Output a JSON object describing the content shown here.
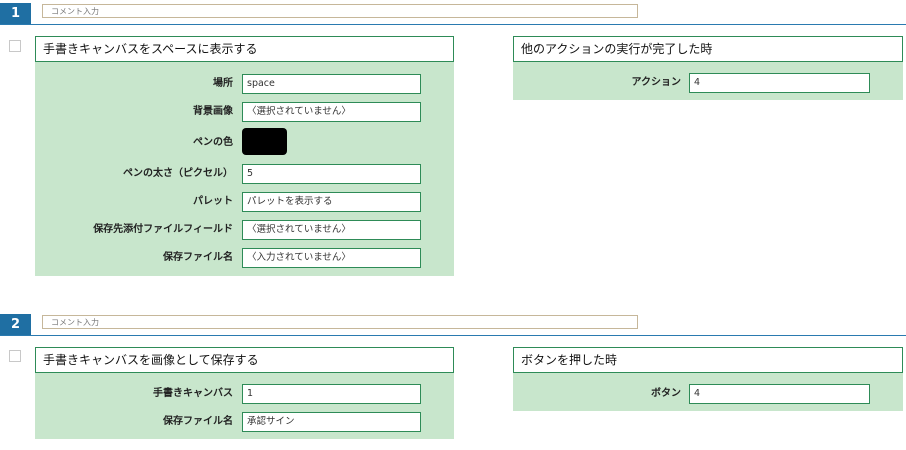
{
  "blocks": [
    {
      "number": "1",
      "comment_placeholder": "コメント入力",
      "action": {
        "title": "手書きキャンバスをスペースに表示する",
        "fields": [
          {
            "label": "場所",
            "value": "space"
          },
          {
            "label": "背景画像",
            "value": "〈選択されていません〉"
          },
          {
            "label": "ペンの色",
            "color": "#000000"
          },
          {
            "label": "ペンの太さ（ピクセル）",
            "value": "5"
          },
          {
            "label": "パレット",
            "value": "パレットを表示する"
          },
          {
            "label": "保存先添付ファイルフィールド",
            "value": "〈選択されていません〉"
          },
          {
            "label": "保存ファイル名",
            "value": "〈入力されていません〉"
          }
        ]
      },
      "trigger": {
        "title": "他のアクションの実行が完了した時",
        "fields": [
          {
            "label": "アクション",
            "value": "4"
          }
        ]
      }
    },
    {
      "number": "2",
      "comment_placeholder": "コメント入力",
      "action": {
        "title": "手書きキャンバスを画像として保存する",
        "fields": [
          {
            "label": "手書きキャンバス",
            "value": "1"
          },
          {
            "label": "保存ファイル名",
            "value": "承認サイン"
          }
        ]
      },
      "trigger": {
        "title": "ボタンを押した時",
        "fields": [
          {
            "label": "ボタン",
            "value": "4"
          }
        ]
      }
    }
  ],
  "colors": {
    "badge": "#1f6fa3",
    "panel_bg": "#c8e6cc",
    "panel_border": "#2e8b57",
    "header_line": "#2a7ab0"
  }
}
